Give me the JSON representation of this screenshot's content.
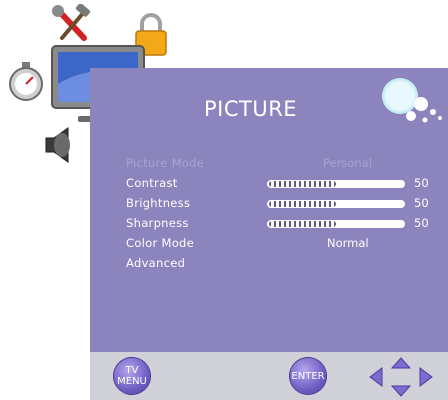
{
  "menu": {
    "title": "PICTURE",
    "items": [
      {
        "label": "Picture Mode",
        "value": "Personal",
        "dim": true
      },
      {
        "label": "Contrast",
        "level": 0.5,
        "number": "50"
      },
      {
        "label": "Brightness",
        "level": 0.5,
        "number": "50"
      },
      {
        "label": "Sharpness",
        "level": 0.5,
        "number": "50"
      },
      {
        "label": "Color Mode",
        "value": "Normal"
      },
      {
        "label": "Advanced"
      }
    ]
  },
  "side_icons": [
    "tools-icon",
    "lock-icon",
    "timer-icon",
    "tv-picture-icon",
    "speaker-icon"
  ],
  "footer": {
    "menu_button": {
      "line1": "TV",
      "line2": "MENU"
    },
    "enter_button": "ENTER",
    "nav_icon": "arrow-keys-icon"
  },
  "colors": {
    "panel": "#8b84bd",
    "footer": "#d0d0d8",
    "dim_text": "#a9a4d6"
  }
}
